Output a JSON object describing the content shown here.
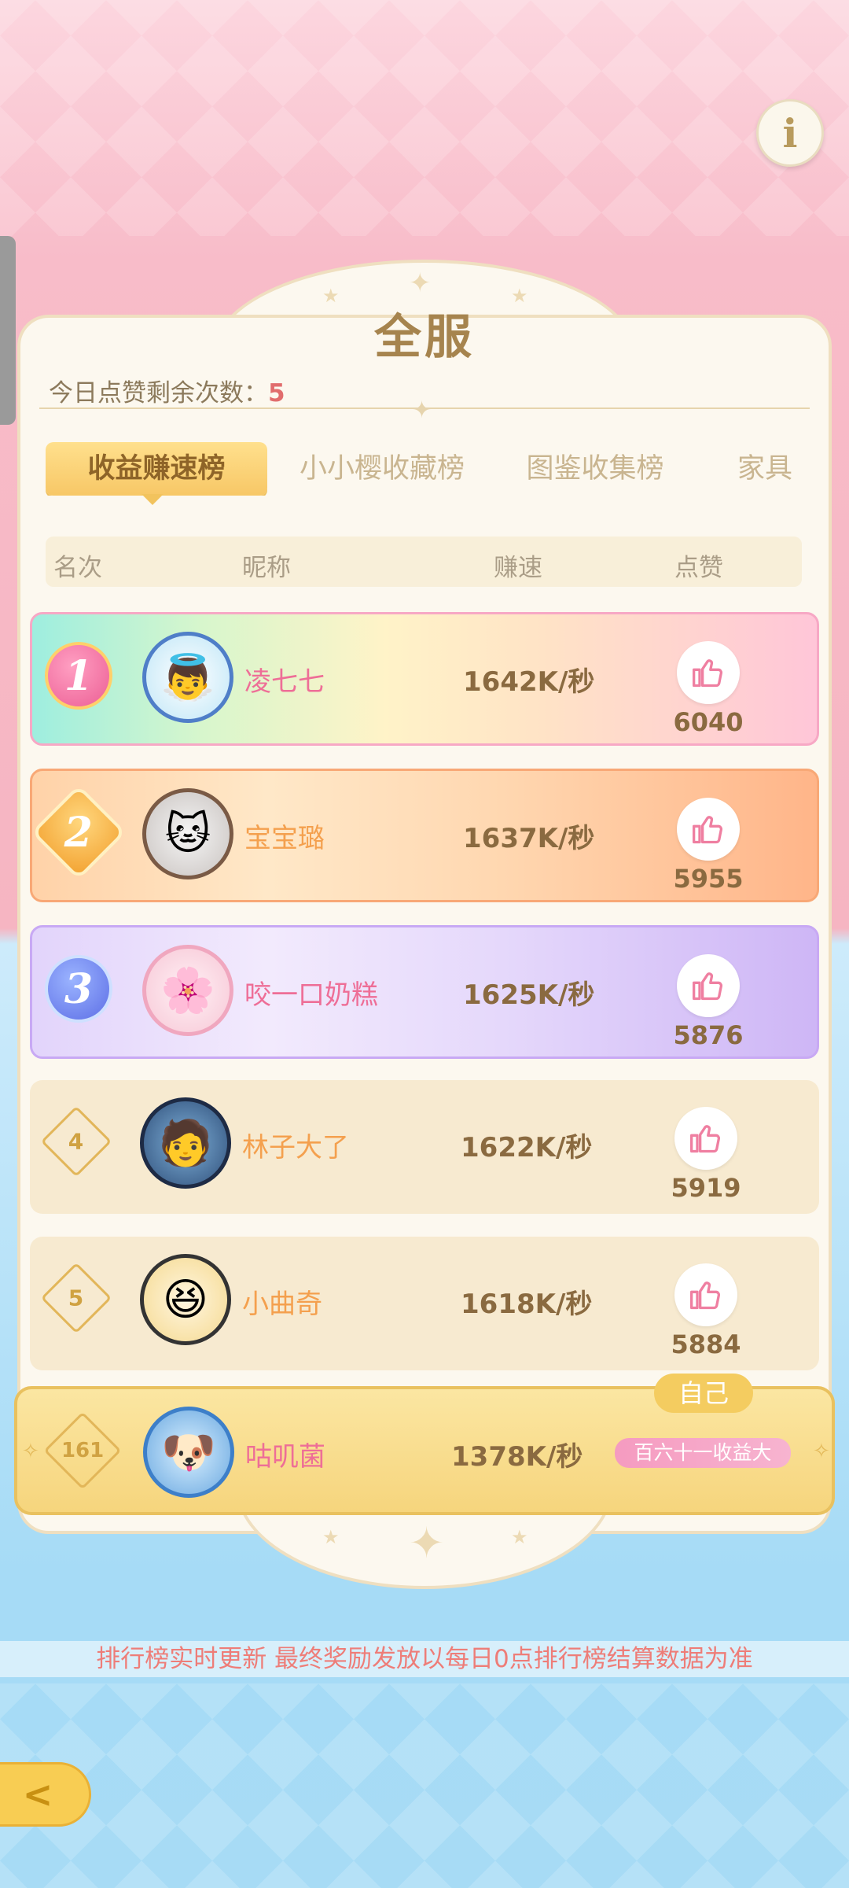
{
  "header": {
    "info_icon_glyph": "i",
    "panel_title": "全服"
  },
  "likes_remaining": {
    "label": "今日点赞剩余次数：",
    "value": "5"
  },
  "tabs": [
    {
      "label": "收益赚速榜",
      "active": true
    },
    {
      "label": "小小樱收藏榜",
      "active": false
    },
    {
      "label": "图鉴收集榜",
      "active": false
    },
    {
      "label": "家具",
      "active": false
    }
  ],
  "columns": {
    "rank": "名次",
    "nickname": "昵称",
    "speed": "赚速",
    "likes": "点赞"
  },
  "rows": [
    {
      "rank": "1",
      "nickname": "凌七七",
      "speed": "1642K/秒",
      "likes": "6040",
      "avatar_icon": "👼"
    },
    {
      "rank": "2",
      "nickname": "宝宝璐",
      "speed": "1637K/秒",
      "likes": "5955",
      "avatar_icon": "🐱"
    },
    {
      "rank": "3",
      "nickname": "咬一口奶糕",
      "speed": "1625K/秒",
      "likes": "5876",
      "avatar_icon": "🌸"
    },
    {
      "rank": "4",
      "nickname": "林子大了",
      "speed": "1622K/秒",
      "likes": "5919",
      "avatar_icon": "🧑"
    },
    {
      "rank": "5",
      "nickname": "小曲奇",
      "speed": "1618K/秒",
      "likes": "5884",
      "avatar_icon": "😆"
    }
  ],
  "self_row": {
    "tag": "自己",
    "rank": "161",
    "nickname": "咕叽菌",
    "speed": "1378K/秒",
    "title_badge": "百六十一收益大",
    "avatar_icon": "🐶"
  },
  "notice": "排行榜实时更新 最终奖励发放以每日0点排行榜结算数据为准",
  "back_button_glyph": "<",
  "colors": {
    "accent_gold": "#f7c766",
    "title_brown": "#a6844e",
    "highlight_red": "#e16d6d",
    "pink_nick": "#ee6e97",
    "orange_nick": "#f4a04e"
  }
}
